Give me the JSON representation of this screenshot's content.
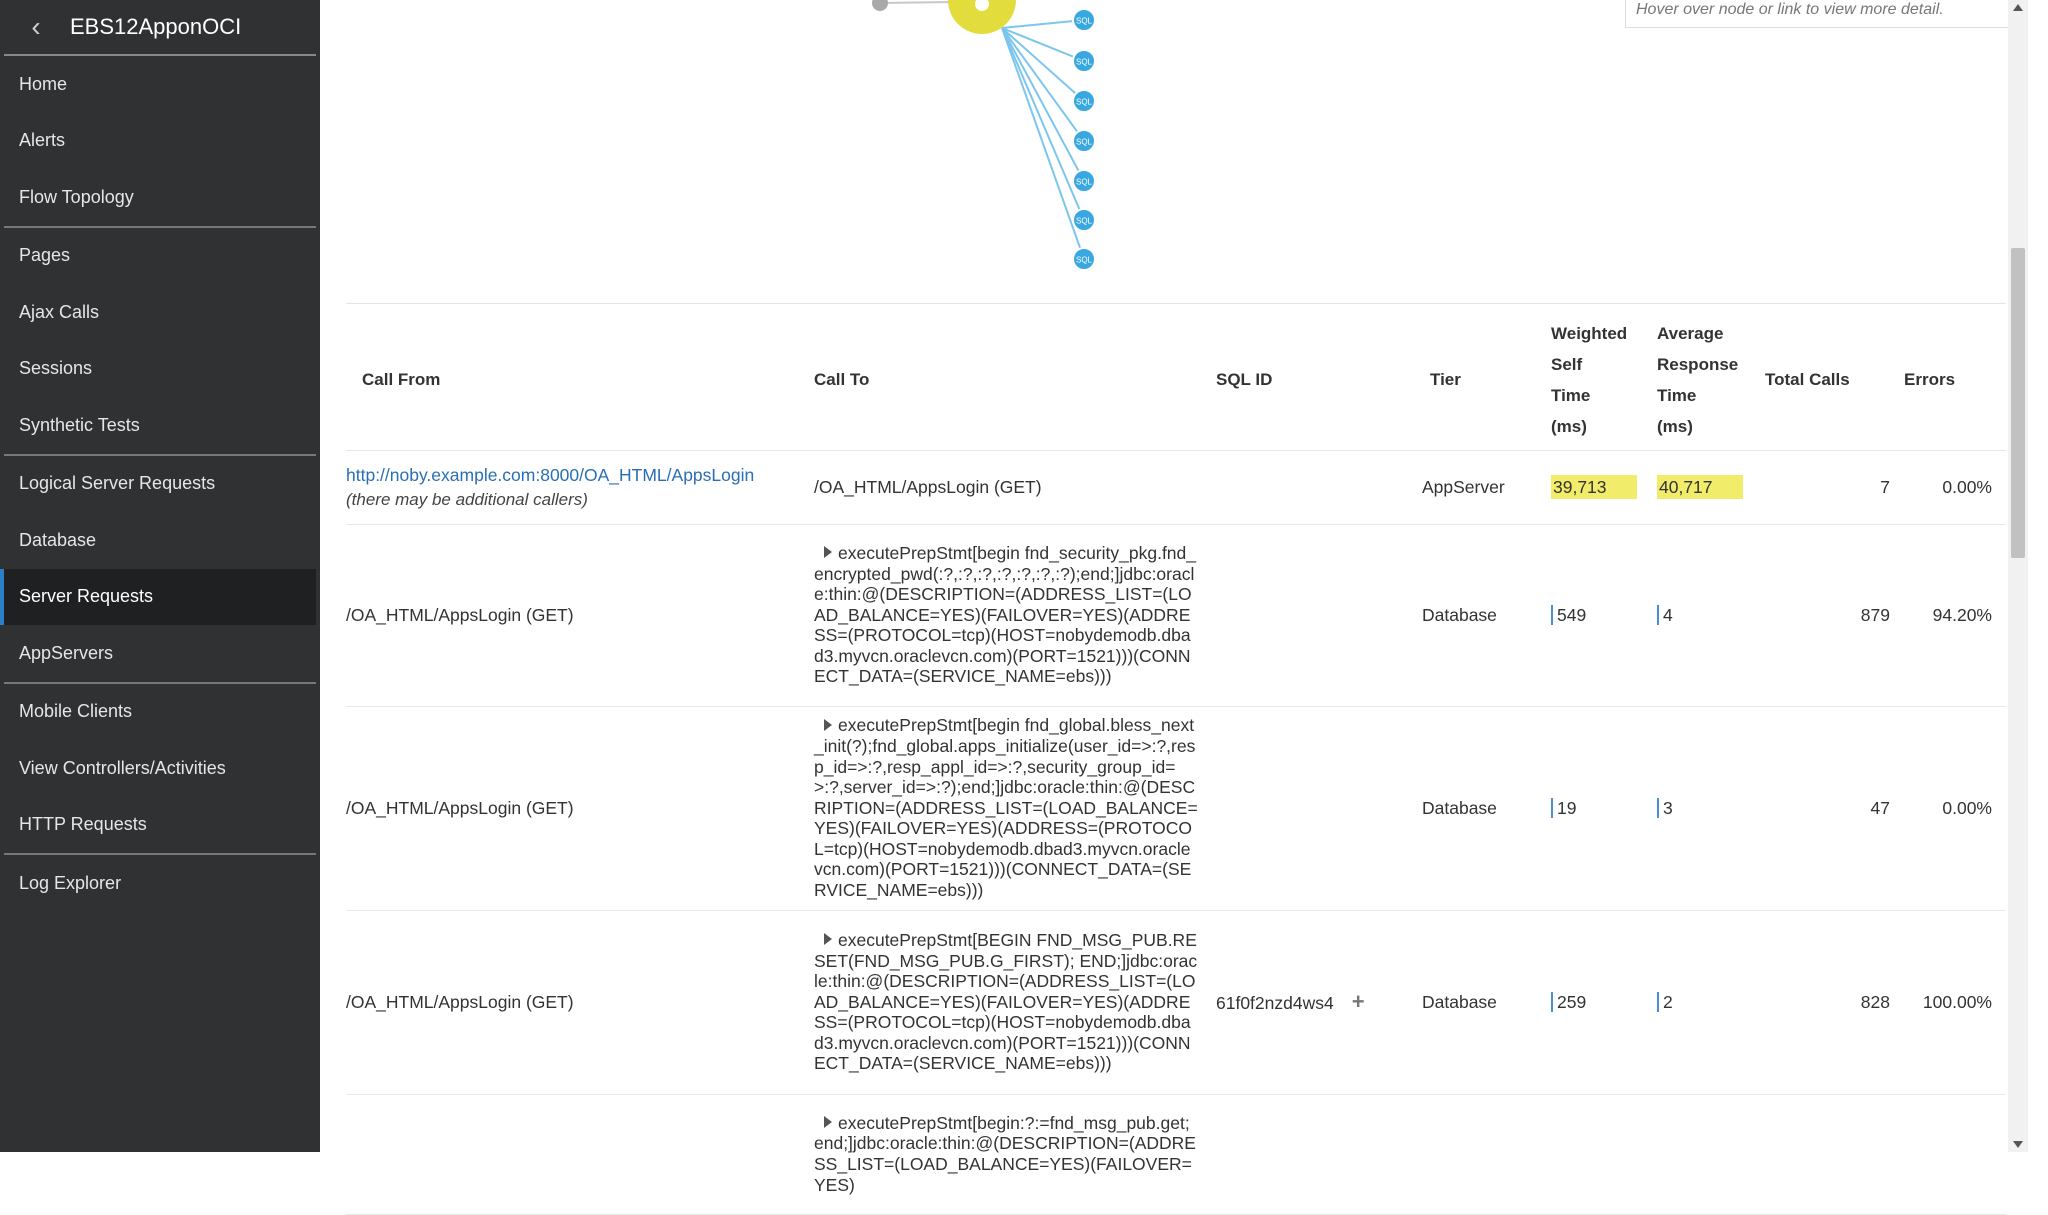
{
  "sidebar": {
    "title": "EBS12ApponOCI",
    "back_icon": "chevron-left-icon",
    "groups": [
      [
        "Home",
        "Alerts",
        "Flow Topology"
      ],
      [
        "Pages",
        "Ajax Calls",
        "Sessions",
        "Synthetic Tests"
      ],
      [
        "Logical Server Requests",
        "Database",
        "Server Requests",
        "AppServers"
      ],
      [
        "Mobile Clients",
        "View Controllers/Activities",
        "HTTP Requests"
      ],
      [
        "Log Explorer"
      ]
    ],
    "active": "Server Requests"
  },
  "topology": {
    "hint": "Hover over node or link to view more detail.",
    "node_label": "SQL",
    "hub_color": "#e2dd3c",
    "sql_node_color": "#3aa8e0",
    "link_color": "#7cc6ee"
  },
  "table": {
    "headers": {
      "call_from": "Call From",
      "call_to": "Call To",
      "sql_id": "SQL ID",
      "tier": "Tier",
      "weighted_self_time": [
        "Weighted",
        "Self",
        "Time",
        "(ms)"
      ],
      "avg_response_time": [
        "Average",
        "Response",
        "Time",
        "(ms)"
      ],
      "total_calls": "Total Calls",
      "errors": "Errors"
    },
    "rows": [
      {
        "call_from_link": "http://noby.example.com:8000/OA_HTML/AppsLogin",
        "call_from_note": "(there may be additional callers)",
        "call_to": "/OA_HTML/AppsLogin (GET)",
        "sql_id": "",
        "tier": "AppServer",
        "weighted_self_time": "39,713",
        "avg_response_time": "40,717",
        "total_calls": "7",
        "errors": "0.00%"
      },
      {
        "call_from": "/OA_HTML/AppsLogin (GET)",
        "call_to": "executePrepStmt[begin fnd_security_pkg.fnd_encrypted_pwd(:?,:?,:?,:?,:?,:?,:?);end;]jdbc:oracle:thin:@(DESCRIPTION=(ADDRESS_LIST=(LOAD_BALANCE=YES)(FAILOVER=YES)(ADDRESS=(PROTOCOL=tcp)(HOST=nobydemodb.dbad3.myvcn.oraclevcn.com)(PORT=1521)))(CONNECT_DATA=(SERVICE_NAME=ebs)))",
        "sql_id": "",
        "tier": "Database",
        "weighted_self_time": "549",
        "avg_response_time": "4",
        "total_calls": "879",
        "errors": "94.20%"
      },
      {
        "call_from": "/OA_HTML/AppsLogin (GET)",
        "call_to": "executePrepStmt[begin fnd_global.bless_next_init(?);fnd_global.apps_initialize(user_id=>:?,resp_id=>:?,resp_appl_id=>:?,security_group_id=>:?,server_id=>:?);end;]jdbc:oracle:thin:@(DESCRIPTION=(ADDRESS_LIST=(LOAD_BALANCE=YES)(FAILOVER=YES)(ADDRESS=(PROTOCOL=tcp)(HOST=nobydemodb.dbad3.myvcn.oraclevcn.com)(PORT=1521)))(CONNECT_DATA=(SERVICE_NAME=ebs)))",
        "sql_id": "",
        "tier": "Database",
        "weighted_self_time": "19",
        "avg_response_time": "3",
        "total_calls": "47",
        "errors": "0.00%"
      },
      {
        "call_from": "/OA_HTML/AppsLogin (GET)",
        "call_to": "executePrepStmt[BEGIN FND_MSG_PUB.RESET(FND_MSG_PUB.G_FIRST); END;]jdbc:oracle:thin:@(DESCRIPTION=(ADDRESS_LIST=(LOAD_BALANCE=YES)(FAILOVER=YES)(ADDRESS=(PROTOCOL=tcp)(HOST=nobydemodb.dbad3.myvcn.oraclevcn.com)(PORT=1521)))(CONNECT_DATA=(SERVICE_NAME=ebs)))",
        "sql_id": "61f0f2nzd4ws4",
        "tier": "Database",
        "weighted_self_time": "259",
        "avg_response_time": "2",
        "total_calls": "828",
        "errors": "100.00%"
      },
      {
        "call_from": "",
        "call_to": "executePrepStmt[begin:?:=fnd_msg_pub.get;end;]jdbc:oracle:thin:@(DESCRIPTION=(ADDRESS_LIST=(LOAD_BALANCE=YES)(FAILOVER=YES)",
        "sql_id": "",
        "tier": "",
        "weighted_self_time": "",
        "avg_response_time": "",
        "total_calls": "",
        "errors": ""
      }
    ]
  }
}
